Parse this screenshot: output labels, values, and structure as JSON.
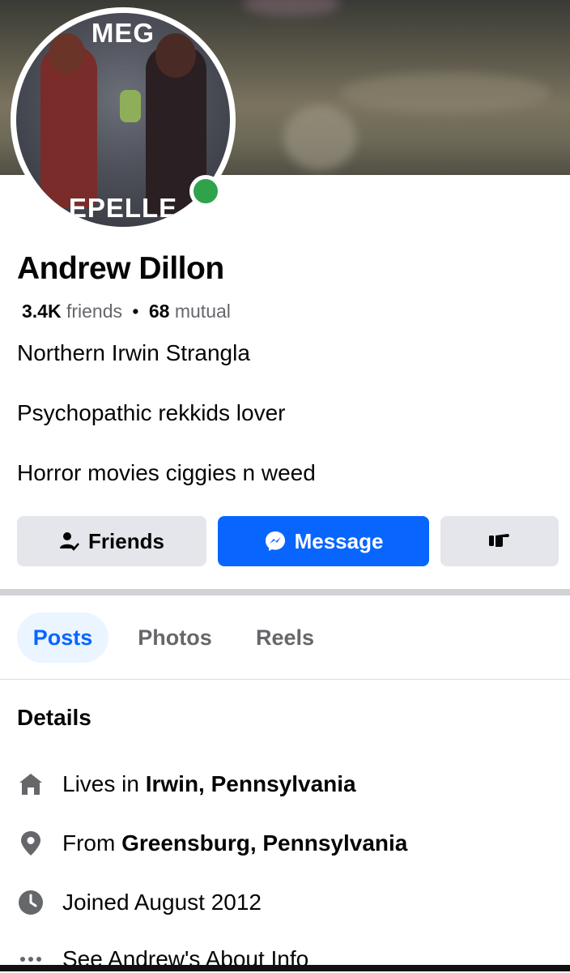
{
  "profile": {
    "avatar_text_top": "MEG",
    "avatar_text_bottom": "EPELLE",
    "name": "Andrew Dillon",
    "friends_count": "3.4K",
    "friends_label": "friends",
    "separator": "•",
    "mutual_count": "68",
    "mutual_label": "mutual",
    "bio": [
      "Northern Irwin Strangla",
      "Psychopathic rekkids lover",
      "Horror movies ciggies n weed"
    ],
    "online": true,
    "online_color": "#31a24c"
  },
  "actions": {
    "friends_label": "Friends",
    "message_label": "Message",
    "poke_icon": "poke-hand-icon"
  },
  "tabs": [
    {
      "label": "Posts",
      "active": true
    },
    {
      "label": "Photos",
      "active": false
    },
    {
      "label": "Reels",
      "active": false
    }
  ],
  "details": {
    "title": "Details",
    "lives_prefix": "Lives in",
    "lives_place": "Irwin, Pennsylvania",
    "from_prefix": "From",
    "from_place": "Greensburg, Pennsylvania",
    "joined": "Joined August 2012",
    "about_link": "See Andrew's About Info"
  },
  "colors": {
    "accent": "#0866ff",
    "button_gray": "#e4e6eb",
    "muted_text": "#65676b",
    "tab_active_bg": "#ebf5ff"
  }
}
